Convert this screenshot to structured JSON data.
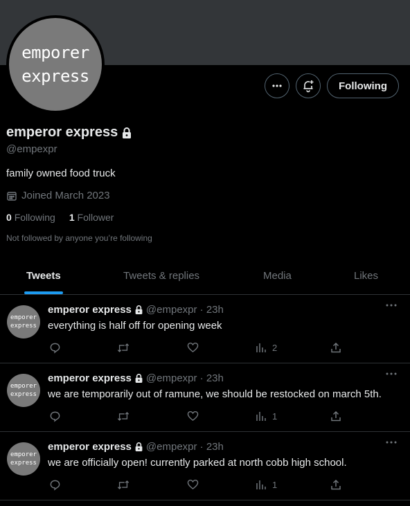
{
  "profile": {
    "avatar_text": [
      "emporer",
      "express"
    ],
    "name": "emperor express",
    "handle": "@empexpr",
    "bio": "family owned food truck",
    "joined": "Joined March 2023",
    "following_count": "0",
    "following_label": "Following",
    "followers_count": "1",
    "followers_label": "Follower",
    "not_followed": "Not followed by anyone you’re following"
  },
  "actions": {
    "follow_label": "Following"
  },
  "tabs": [
    {
      "label": "Tweets",
      "active": true
    },
    {
      "label": "Tweets & replies",
      "active": false
    },
    {
      "label": "Media",
      "active": false
    },
    {
      "label": "Likes",
      "active": false
    }
  ],
  "tweets": [
    {
      "name": "emperor express",
      "meta": "@empexpr · 23h",
      "text": "everything is half off for opening week",
      "views": "2"
    },
    {
      "name": "emperor express",
      "meta": "@empexpr · 23h",
      "text": "we are temporarily out of ramune, we should be restocked on march 5th.",
      "views": "1"
    },
    {
      "name": "emperor express",
      "meta": "@empexpr · 23h",
      "text": "we are officially open! currently parked at north cobb high school.",
      "views": "1"
    }
  ],
  "colors": {
    "accent": "#1d9bf0",
    "muted": "#71767b",
    "border": "#2f3336"
  }
}
